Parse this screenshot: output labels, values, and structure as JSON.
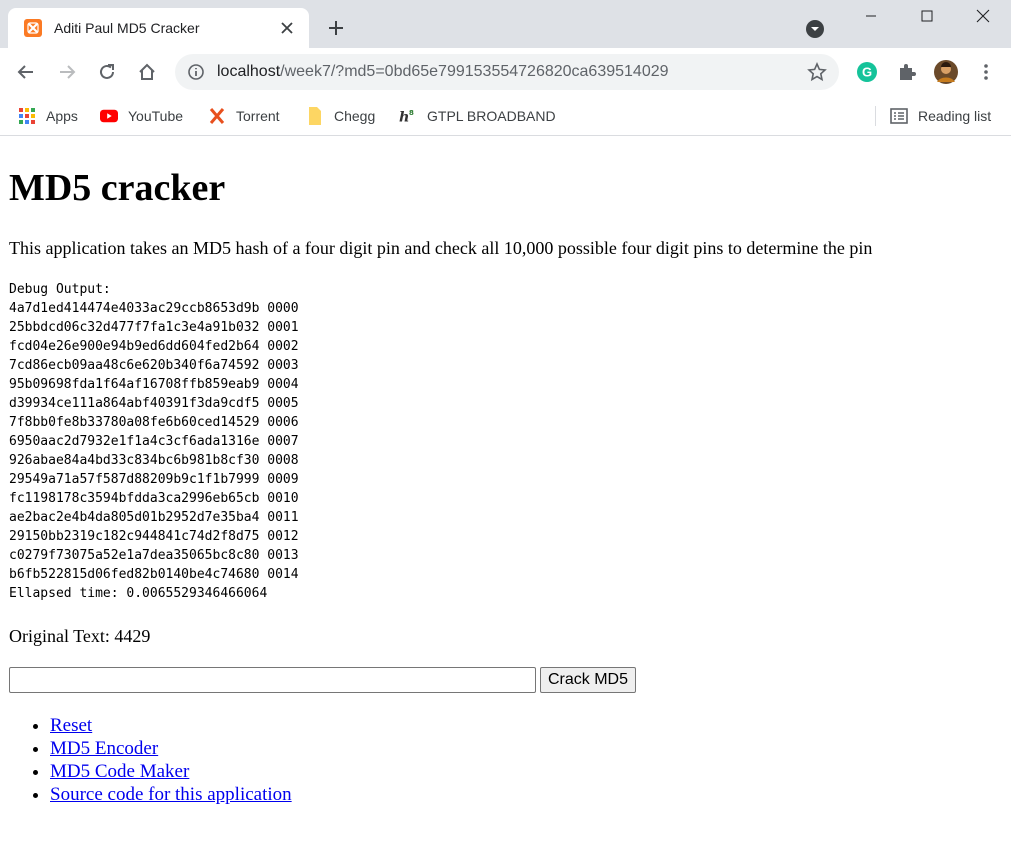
{
  "browser": {
    "tab_title": "Aditi Paul MD5 Cracker",
    "url_host": "localhost",
    "url_rest": "/week7/?md5=0bd65e799153554726820ca639514029",
    "bookmarks": [
      {
        "label": "Apps",
        "icon": "apps-grid-icon"
      },
      {
        "label": "YouTube",
        "icon": "youtube-icon"
      },
      {
        "label": "Torrent",
        "icon": "torrent-icon"
      },
      {
        "label": "Chegg",
        "icon": "chegg-icon"
      },
      {
        "label": "GTPL BROADBAND",
        "icon": "gtpl-icon"
      }
    ],
    "reading_list": "Reading list",
    "colors": {
      "accent": "#1a73e8",
      "grammarly": "#15c39a",
      "youtube": "#ff0000",
      "favicon": "#fb7a24"
    }
  },
  "page": {
    "title": "MD5 cracker",
    "description": "This application takes an MD5 hash of a four digit pin and check all 10,000 possible four digit pins to determine the pin",
    "debug_output": "Debug Output:\n4a7d1ed414474e4033ac29ccb8653d9b 0000\n25bbdcd06c32d477f7fa1c3e4a91b032 0001\nfcd04e26e900e94b9ed6dd604fed2b64 0002\n7cd86ecb09aa48c6e620b340f6a74592 0003\n95b09698fda1f64af16708ffb859eab9 0004\nd39934ce111a864abf40391f3da9cdf5 0005\n7f8bb0fe8b33780a08fe6b60ced14529 0006\n6950aac2d7932e1f1a4c3cf6ada1316e 0007\n926abae84a4bd33c834bc6b981b8cf30 0008\n29549a71a57f587d88209b9c1f1b7999 0009\nfc1198178c3594bfdda3ca2996eb65cb 0010\nae2bac2e4b4da805d01b2952d7e35ba4 0011\n29150bb2319c182c944841c74d2f8d75 0012\nc0279f73075a52e1a7dea35065bc8c80 0013\nb6fb522815d06fed82b0140be4c74680 0014\nEllapsed time: 0.0065529346466064",
    "original_text": "Original Text: 4429",
    "input_value": "",
    "crack_button": "Crack MD5",
    "links": [
      "Reset",
      "MD5 Encoder",
      "MD5 Code Maker",
      "Source code for this application"
    ]
  }
}
